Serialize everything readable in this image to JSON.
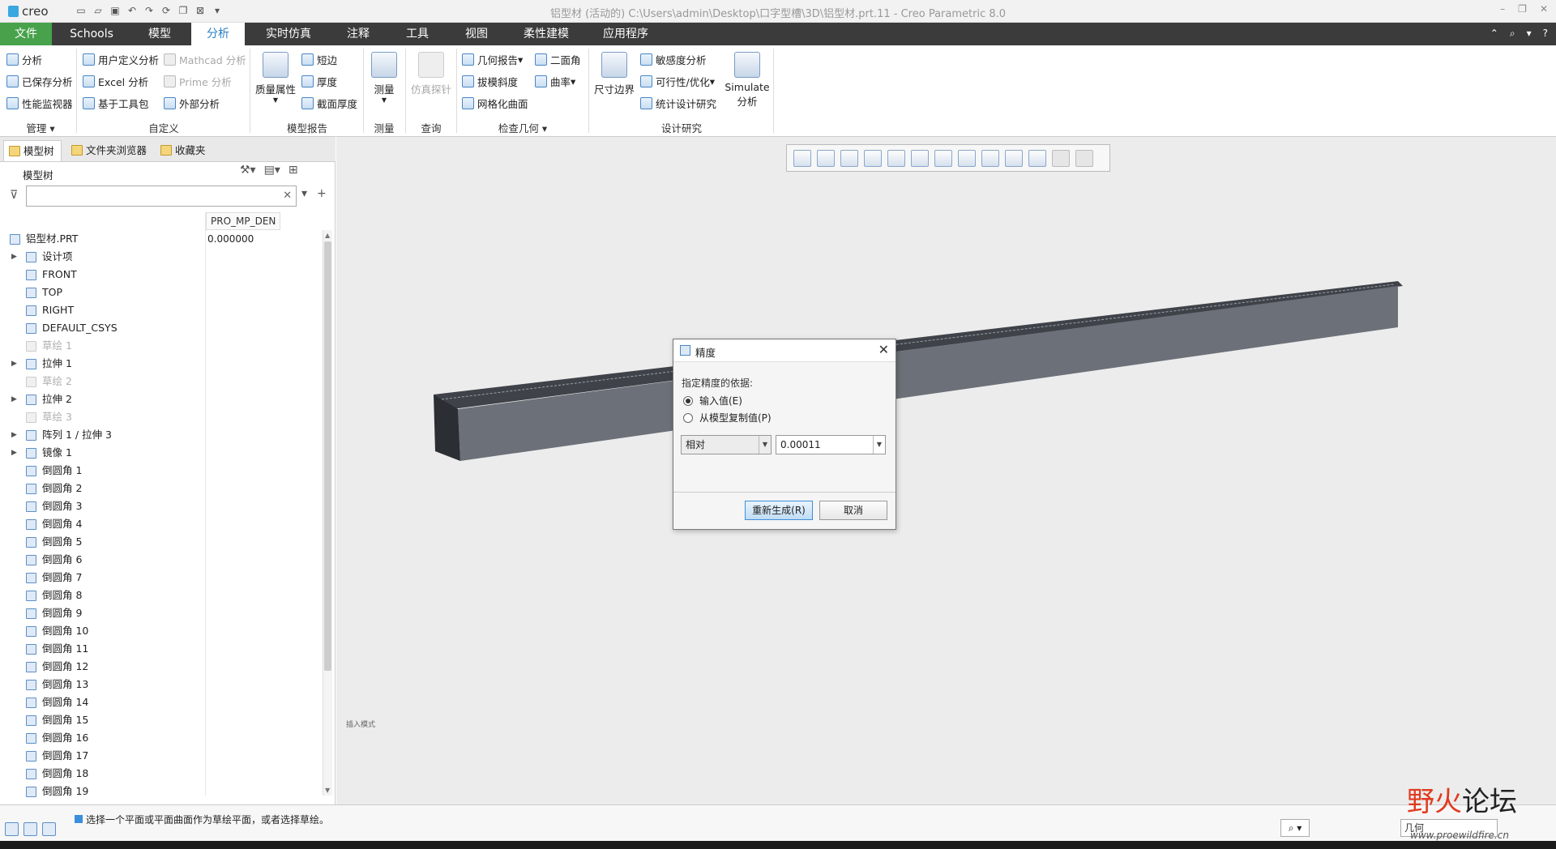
{
  "window": {
    "app_name": "creo",
    "title": "铝型材 (活动的) C:\\Users\\admin\\Desktop\\口字型槽\\3D\\铝型材.prt.11 - Creo Parametric 8.0"
  },
  "menu": {
    "tabs": [
      "文件",
      "Schools",
      "模型",
      "分析",
      "实时仿真",
      "注释",
      "工具",
      "视图",
      "柔性建模",
      "应用程序"
    ],
    "active": "分析"
  },
  "ribbon": {
    "manage": {
      "items": [
        "分析",
        "已保存分析",
        "性能监视器"
      ],
      "group": "管理"
    },
    "custom": {
      "items": [
        "用户定义分析",
        "Excel 分析",
        "基于工具包",
        "Mathcad 分析",
        "Prime 分析",
        "外部分析"
      ],
      "group": "自定义"
    },
    "model_report": {
      "big": "质量属性",
      "items": [
        "短边",
        "厚度",
        "截面厚度"
      ],
      "group": "模型报告"
    },
    "measure": {
      "big": "测量",
      "group": "测量"
    },
    "query": {
      "big": "仿真探针",
      "group": "查询"
    },
    "inspect": {
      "items": [
        "几何报告",
        "拔模斜度",
        "网格化曲面",
        "二面角",
        "曲率"
      ],
      "group": "检查几何"
    },
    "design_study": {
      "items": [
        "尺寸边界",
        "敏感度分析",
        "可行性/优化",
        "统计设计研究",
        "Simulate 分析"
      ],
      "group": "设计研究"
    }
  },
  "panel": {
    "tabs": [
      "模型树",
      "文件夹浏览器",
      "收藏夹"
    ],
    "tree_label": "模型树",
    "column": "PRO_MP_DEN",
    "filter_placeholder": "",
    "root": {
      "label": "铝型材.PRT",
      "value": "0.000000"
    },
    "items": [
      {
        "label": "设计项",
        "expand": true
      },
      {
        "label": "FRONT"
      },
      {
        "label": "TOP"
      },
      {
        "label": "RIGHT"
      },
      {
        "label": "DEFAULT_CSYS"
      },
      {
        "label": "草绘 1",
        "dim": true
      },
      {
        "label": "拉伸 1",
        "expand": true
      },
      {
        "label": "草绘 2",
        "dim": true
      },
      {
        "label": "拉伸 2",
        "expand": true
      },
      {
        "label": "草绘 3",
        "dim": true
      },
      {
        "label": "阵列 1 / 拉伸 3",
        "expand": true
      },
      {
        "label": "镜像 1",
        "expand": true
      },
      {
        "label": "倒圆角 1"
      },
      {
        "label": "倒圆角 2"
      },
      {
        "label": "倒圆角 3"
      },
      {
        "label": "倒圆角 4"
      },
      {
        "label": "倒圆角 5"
      },
      {
        "label": "倒圆角 6"
      },
      {
        "label": "倒圆角 7"
      },
      {
        "label": "倒圆角 8"
      },
      {
        "label": "倒圆角 9"
      },
      {
        "label": "倒圆角 10"
      },
      {
        "label": "倒圆角 11"
      },
      {
        "label": "倒圆角 12"
      },
      {
        "label": "倒圆角 13"
      },
      {
        "label": "倒圆角 14"
      },
      {
        "label": "倒圆角 15"
      },
      {
        "label": "倒圆角 16"
      },
      {
        "label": "倒圆角 17"
      },
      {
        "label": "倒圆角 18"
      },
      {
        "label": "倒圆角 19"
      }
    ]
  },
  "viewport": {
    "watermark": "插入模式"
  },
  "dialog": {
    "title": "精度",
    "prompt": "指定精度的依据:",
    "options": [
      "输入值(E)",
      "从模型复制值(P)"
    ],
    "selected": 0,
    "mode": "相对",
    "value": "0.00011",
    "regen": "重新生成(R)",
    "cancel": "取消"
  },
  "status": {
    "message": "选择一个平面或平面曲面作为草绘平面，或者选择草绘。",
    "selection_filter": "几何"
  },
  "brand": {
    "name_a": "野火",
    "name_b": "论坛",
    "url": "www.proewildfire.cn"
  }
}
